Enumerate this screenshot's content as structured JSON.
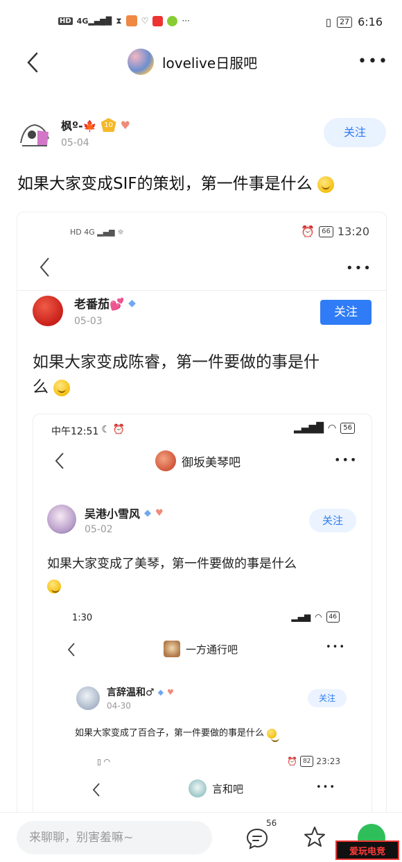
{
  "status_bar": {
    "left_icons": [
      "HD",
      "4G",
      "signal-bars",
      "hourglass-icon",
      "app-icon",
      "heart-icon",
      "calendar-icon",
      "app-icon"
    ],
    "more": "···",
    "battery": "27",
    "time": "6:16"
  },
  "header": {
    "forum_name": "lovelive日服吧"
  },
  "post": {
    "author": "枫º-🍁",
    "level": "10",
    "date": "05-04",
    "follow_label": "关注",
    "title": "如果大家变成SIF的策划，第一件事是什么"
  },
  "nested1": {
    "status_time": "13:20",
    "battery": "66",
    "author": "老番茄💕",
    "date": "05-03",
    "follow_label": "关注",
    "title_line1": "如果大家变成陈睿，第一件要做的事是什",
    "title_line2": "么"
  },
  "nested2": {
    "status_time": "中午12:51",
    "battery": "56",
    "forum_name": "御坂美琴吧",
    "author": "吴港小雪风",
    "date": "05-02",
    "follow_label": "关注",
    "title": "如果大家变成了美琴，第一件要做的事是什么"
  },
  "nested3": {
    "status_time": "1:30",
    "battery": "46",
    "forum_name": "一方通行吧",
    "author": "言辞温和♂",
    "date": "04-30",
    "follow_label": "关注",
    "title": "如果大家变成了百合子，第一件要做的事是什么"
  },
  "nested4": {
    "battery": "82",
    "status_time": "23:23",
    "forum_name": "言和吧"
  },
  "bottom_bar": {
    "input_placeholder": "来聊聊，别害羞嘛~",
    "comment_count": "56",
    "watermark": "爱玩电竞"
  },
  "colors": {
    "accent": "#2d7bf4",
    "follow_bg": "#e9f2ff",
    "follow_solid": "#2f7cf6"
  }
}
